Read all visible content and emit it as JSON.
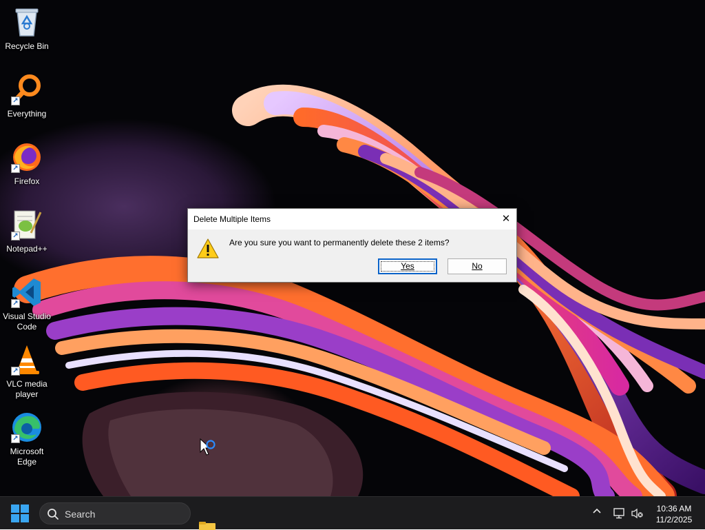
{
  "desktop": {
    "icons": [
      {
        "label": "Recycle Bin",
        "icon": "recycle-bin-icon"
      },
      {
        "label": "Everything",
        "icon": "everything-search-icon"
      },
      {
        "label": "Firefox",
        "icon": "firefox-icon"
      },
      {
        "label": "Notepad++",
        "icon": "notepadpp-icon"
      },
      {
        "label": "Visual Studio Code",
        "icon": "vscode-icon"
      },
      {
        "label": "VLC media player",
        "icon": "vlc-icon"
      },
      {
        "label": "Microsoft Edge",
        "icon": "edge-icon"
      }
    ]
  },
  "dialog": {
    "title": "Delete Multiple Items",
    "close_label": "✕",
    "message": "Are you sure you want to permanently delete these 2 items?",
    "icon": "warning-icon",
    "yes_label": "Yes",
    "no_label": "No"
  },
  "taskbar": {
    "search_label": "Search",
    "tray_chevron": "^",
    "time": "10:36 AM",
    "date": "11/2/2025"
  },
  "colors": {
    "accent": "#0a63c9",
    "taskbar_bg": "#1c1c1e",
    "dialog_bg": "#f0f0f0"
  }
}
